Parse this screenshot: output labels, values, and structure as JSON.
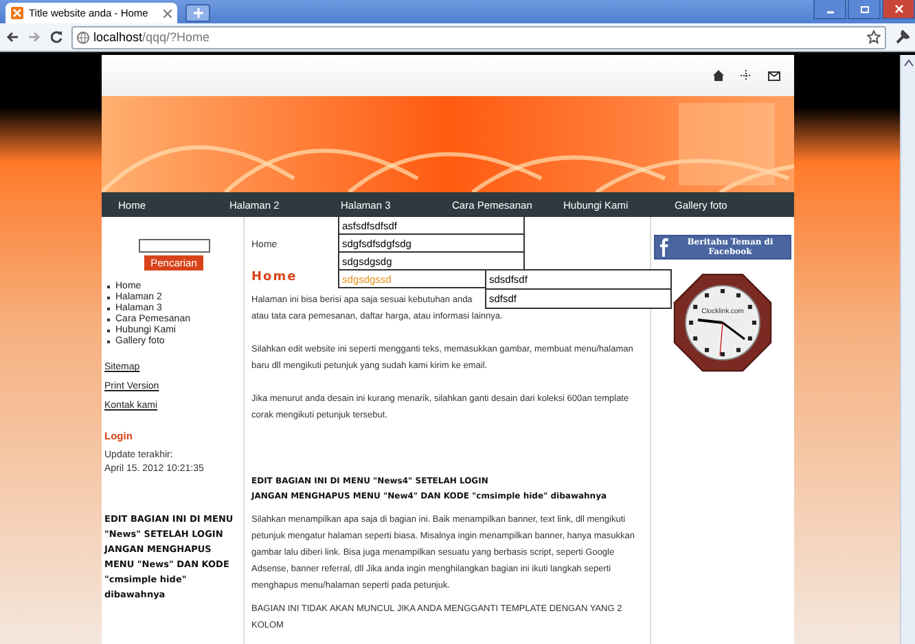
{
  "browser": {
    "tab_title": "Title website anda - Home",
    "url_host": "localhost",
    "url_path": "/qqq/?Home"
  },
  "nav": [
    {
      "label": "Home"
    },
    {
      "label": "Halaman 2"
    },
    {
      "label": "Halaman 3",
      "children": [
        {
          "label": "asfsdfsdfsdf",
          "selected": false
        },
        {
          "label": "sdgfsdfsdgfsdg",
          "selected": false
        },
        {
          "label": "sdgsdgsdg",
          "selected": false
        },
        {
          "label": "sdgsdgssd",
          "selected": true,
          "children": [
            {
              "label": "sdsdfsdf",
              "selected": false
            },
            {
              "label": "sdfsdf",
              "selected": false
            }
          ]
        }
      ]
    },
    {
      "label": "Cara Pemesanan"
    },
    {
      "label": "Hubungi Kami"
    },
    {
      "label": "Gallery foto"
    }
  ],
  "sidebar": {
    "search_button": "Pencarian",
    "menu": [
      "Home",
      "Halaman 2",
      "Halaman 3",
      "Cara Pemesanan",
      "Hubungi Kami",
      "Gallery foto"
    ],
    "links": [
      "Sitemap",
      "Print Version",
      "Kontak kami"
    ],
    "login": "Login",
    "update_label": "Update terakhir:",
    "update_date": "April 15. 2012 10:21:35",
    "news_text": "EDIT BAGIAN INI DI MENU \"News\" SETELAH LOGIN JANGAN MENGHAPUS MENU \"News\" DAN KODE \"cmsimple hide\" dibawahnya"
  },
  "content": {
    "breadcrumb": "Home",
    "heading": "Home",
    "intro_lines": [
      "Halaman ini bisa berisi apa saja sesuai kebutuhan anda",
      "atau tata cara pemesanan, daftar harga, atau informasi lainnya."
    ],
    "paragraphs": [
      "Silahkan edit website ini seperti mengganti teks, memasukkan gambar, membuat menu/halaman baru dll mengikuti petunjuk yang sudah kami kirim ke email.",
      "Jika menurut anda desain ini kurang menarik, silahkan ganti desain dari koleksi 600an template corak mengikuti petunjuk tersebut."
    ],
    "news_heading_lines": [
      "EDIT BAGIAN INI DI MENU \"News4\" SETELAH LOGIN",
      "JANGAN MENGHAPUS MENU \"New4\" DAN KODE \"cmsimple hide\" dibawahnya"
    ],
    "news_paragraphs": [
      "Silahkan menampilkan apa saja di bagian ini. Baik menampilkan banner, text link, dll mengikuti petunjuk mengatur halaman seperti biasa. Misalnya ingin menampilkan banner, hanya masukkan gambar lalu diberi link. Bisa juga menampilkan sesuatu yang berbasis script, seperti Google Adsense, banner referral, dll Jika anda ingin menghilangkan bagian ini ikuti langkah seperti menghapus menu/halaman seperti pada petunjuk.",
      "BAGIAN INI TIDAK AKAN MUNCUL JIKA ANDA MENGGANTI TEMPLATE DENGAN YANG 2 KOLOM"
    ]
  },
  "right": {
    "facebook_button": "Beritahu Teman di Facebook",
    "clock_label": "Clocklink.com"
  }
}
